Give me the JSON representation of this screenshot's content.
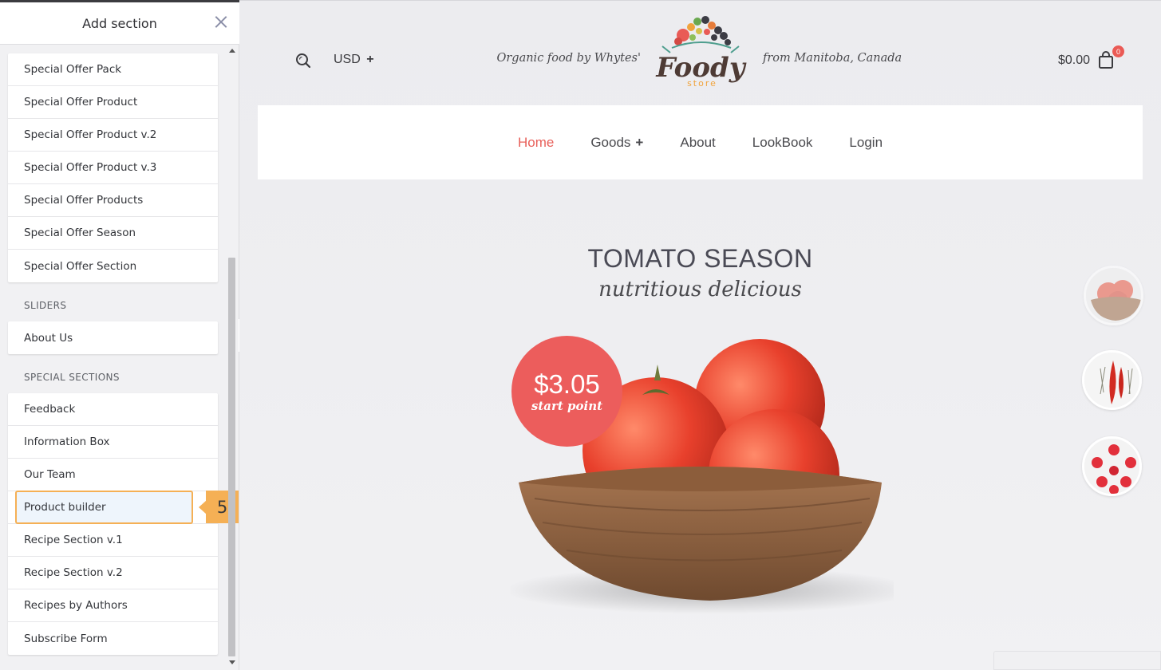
{
  "sidebar": {
    "title": "Add section",
    "group_offers": [
      "Special Offer Pack",
      "Special Offer Product",
      "Special Offer Product v.2",
      "Special Offer Product v.3",
      "Special Offer Products",
      "Special Offer Season",
      "Special Offer Section"
    ],
    "category_sliders": "SLIDERS",
    "group_sliders": [
      "About Us"
    ],
    "category_special": "SPECIAL SECTIONS",
    "group_special": [
      "Feedback",
      "Information Box",
      "Our Team",
      "Product builder",
      "Recipe Section v.1",
      "Recipe Section v.2",
      "Recipes by Authors",
      "Subscribe Form"
    ],
    "highlight_badge": "5"
  },
  "header": {
    "currency": "USD",
    "currency_plus": "+",
    "tagline_left": "Organic food by Whytes'",
    "tagline_right": "from Manitoba, Canada",
    "logo_word": "Foody",
    "logo_sub": "store",
    "cart_amount": "$0.00",
    "cart_count": "0"
  },
  "nav": {
    "items": [
      "Home",
      "Goods",
      "About",
      "LookBook",
      "Login"
    ],
    "goods_plus": "+"
  },
  "hero": {
    "title": "TOMATO SEASON",
    "subtitle": "nutritious delicious",
    "price": "$3.05",
    "price_note": "start point"
  },
  "colors": {
    "accent": "#e8605a",
    "highlight_border": "#f5b055",
    "highlight_fill": "#eef5fc"
  }
}
